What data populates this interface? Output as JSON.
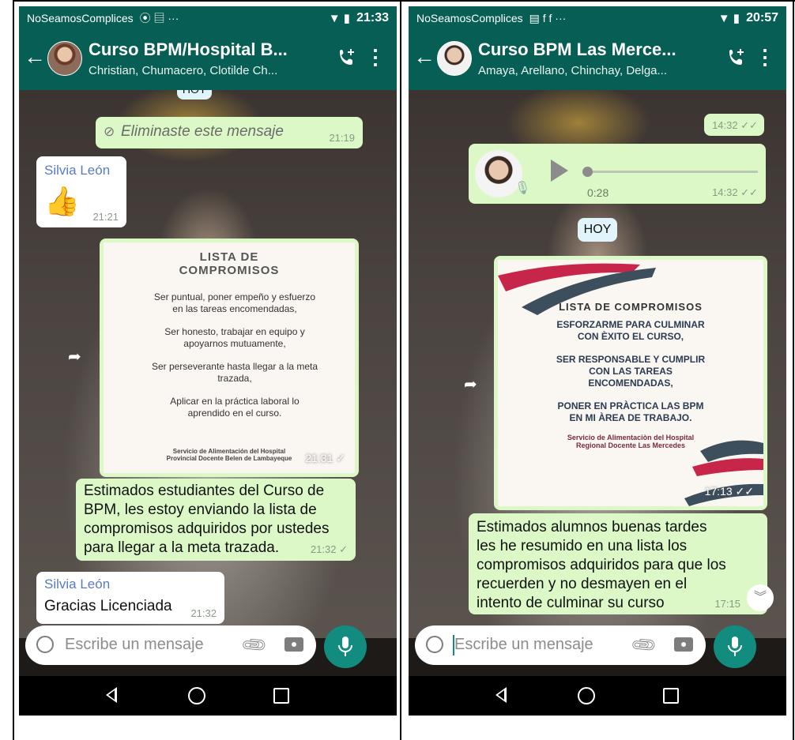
{
  "left": {
    "status": {
      "carrier": "NoSeamosComplices",
      "icons": "⦿ ▤   ···",
      "time": "21:33"
    },
    "header": {
      "title": "Curso BPM/Hospital B...",
      "subtitle": "Christian, Chumacero, Clotilde Ch..."
    },
    "messages": {
      "day_chip": "HOY",
      "deleted": {
        "text": "Eliminaste este mensaje",
        "time": "21:19"
      },
      "silvia1": {
        "sender": "Silvia León",
        "emoji": "👍",
        "time": "21:21"
      },
      "image": {
        "time": "21:31 ✓",
        "title": "LISTA DE\nCOMPROMISOS",
        "lines": [
          "Ser puntual, poner empeño y esfuerzo en las tareas encomendadas,",
          "Ser honesto, trabajar en equipo y apoyarnos mutuamente,",
          "Ser perseverante hasta llegar a la meta trazada,",
          "Aplicar en la práctica laboral lo aprendido en el curso."
        ],
        "footer": "Servicio de Alimentación del Hospital\nProvincial Docente Belen de Lambayeque"
      },
      "long": {
        "text": "Estimados estudiantes del Curso de BPM, les estoy enviando la lista de compromisos adquiridos por ustedes para llegar a la meta trazada.",
        "time": "21:32 ✓"
      },
      "silvia2": {
        "sender": "Silvia León",
        "text": "Gracias Licenciada",
        "time": "21:32"
      }
    },
    "input": {
      "placeholder": "Escribe un mensaje"
    }
  },
  "right": {
    "status": {
      "carrier": "NoSeamosComplices",
      "icons": "▤ f f   ···",
      "time": "20:57"
    },
    "header": {
      "title": "Curso BPM Las Merce...",
      "subtitle": "Amaya, Arellano, Chinchay, Delga..."
    },
    "messages": {
      "top_time": "14:32 ✓✓",
      "audio": {
        "duration": "0:28",
        "time": "14:32 ✓✓",
        "progress": 0
      },
      "day_chip": "HOY",
      "image": {
        "time": "17:13 ✓✓",
        "title": "LISTA DE COMPROMISOS",
        "lines": [
          "ESFORZARME PARA CULMINAR CON ÈXITO EL CURSO,",
          "SER RESPONSABLE Y CUMPLIR CON LAS TAREAS ENCOMENDADAS,",
          "PONER EN PRÀCTICA LAS BPM EN MI ÀREA DE TRABAJO."
        ],
        "footer": "Servicio de Alimentaciòn del Hospital\nRegional Docente Las Mercedes"
      },
      "long": {
        "text": "Estimados alumnos buenas tardes les he resumido en una lista los compromisos adquiridos para que los recuerden y no desmayen en el intento de culminar su curso",
        "time": "17:15"
      }
    },
    "input": {
      "placeholder": "Escribe un mensaje"
    }
  },
  "colors": {
    "header": "#075e54",
    "outgoing": "#dcf8c6",
    "incoming": "#ffffff",
    "accent": "#128c7e"
  },
  "icons": [
    "back-arrow-icon",
    "add-call-icon",
    "more-vert-icon",
    "deleted-icon",
    "emoji-icon",
    "attach-icon",
    "camera-icon",
    "mic-icon",
    "play-icon",
    "forward-icon",
    "scroll-down-icon",
    "nav-back-icon",
    "nav-home-icon",
    "nav-recent-icon"
  ]
}
